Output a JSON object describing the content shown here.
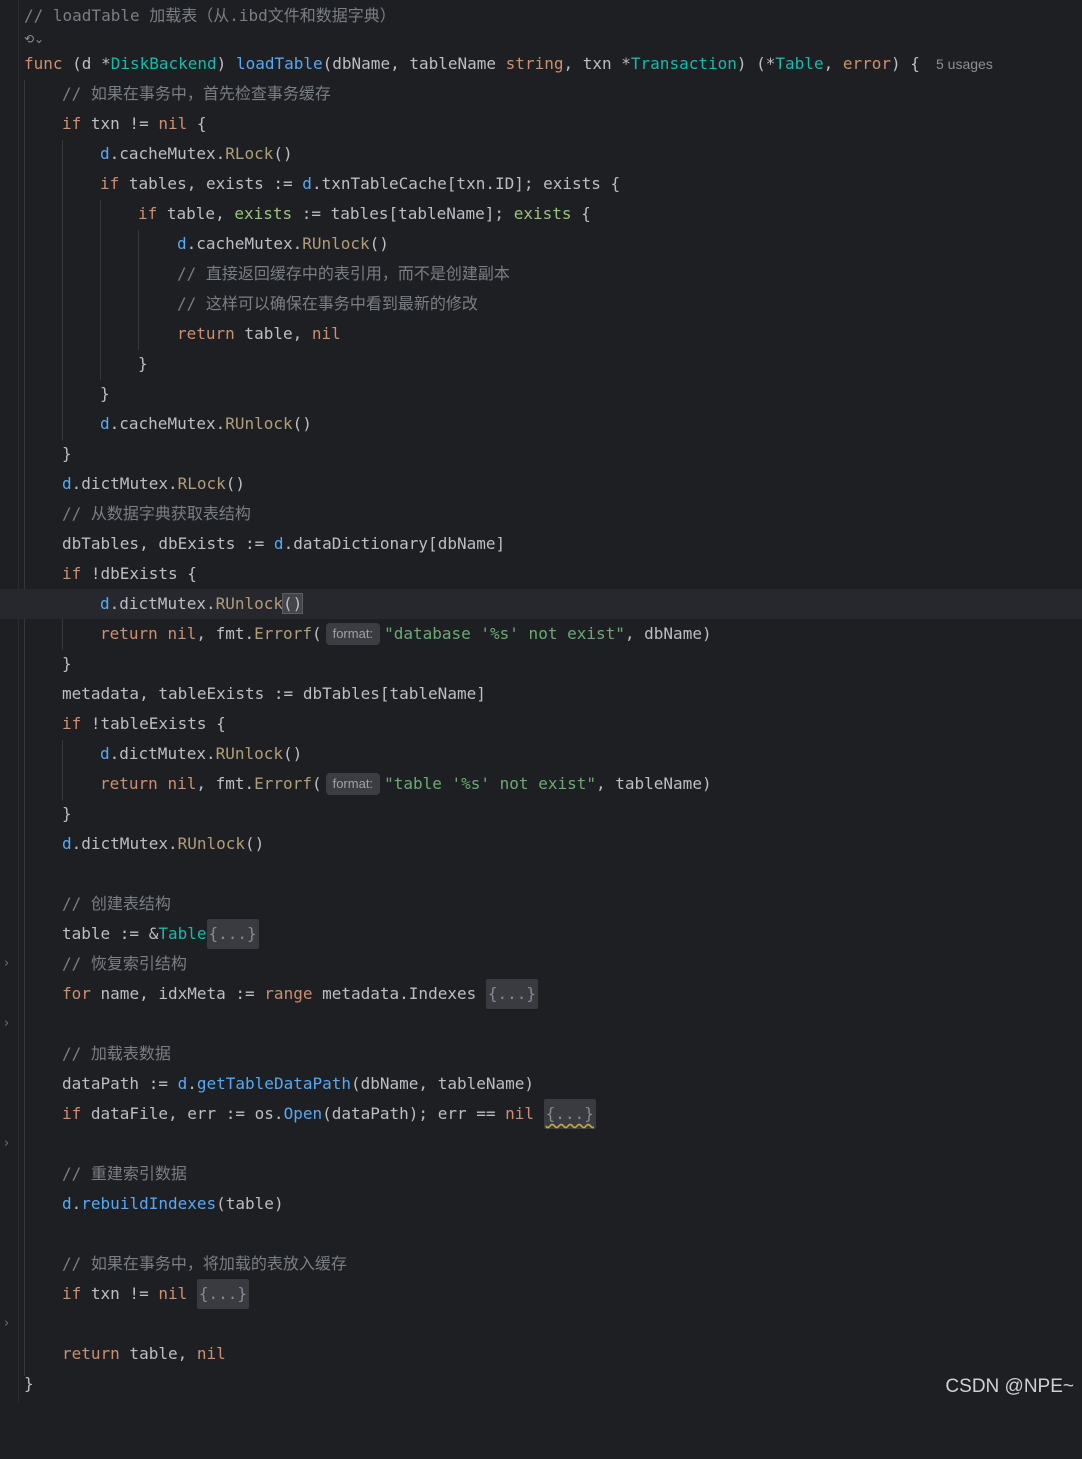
{
  "header_comment": "// loadTable 加载表（从.ibd文件和数据字典）",
  "ai_icon": "⟲⌄",
  "usages": "5 usages",
  "hint_format": "format:",
  "comments": {
    "c1": "// 如果在事务中，首先检查事务缓存",
    "c2": "// 直接返回缓存中的表引用，而不是创建副本",
    "c3": "// 这样可以确保在事务中看到最新的修改",
    "c4": "// 从数据字典获取表结构",
    "c5": "// 创建表结构",
    "c6": "// 恢复索引结构",
    "c7": "// 加载表数据",
    "c8": "// 重建索引数据",
    "c9": "// 如果在事务中，将加载的表放入缓存"
  },
  "strings": {
    "db_not_exist": "\"database '%s' not exist\"",
    "table_not_exist": "\"table '%s' not exist\""
  },
  "fold_placeholder": "{...}",
  "watermark": "CSDN @NPE~"
}
